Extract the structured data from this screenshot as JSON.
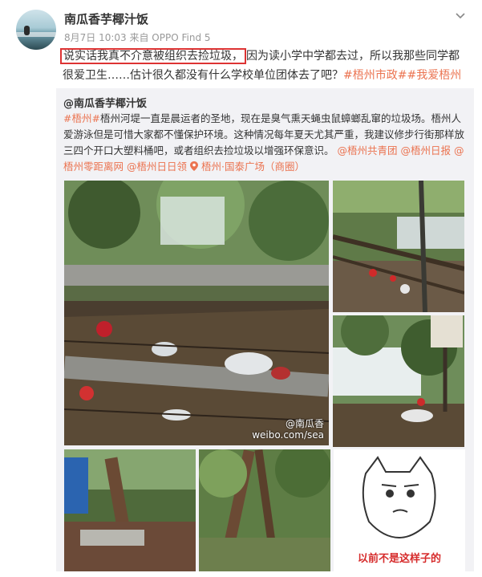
{
  "post": {
    "author": "南瓜香芋椰汁饭",
    "meta": "8月7日 10:03 来自 OPPO Find 5",
    "highlight": "说实话我真不介意被组织去捡垃圾，",
    "text_line1_rest": "因为读小学中学都去过，所以我那些同学都",
    "text_line2": "很爱卫生……估计很久都没有什么学校单位团体去了吧？",
    "tags": [
      "#梧州市政#",
      "#我爱梧州#"
    ]
  },
  "repost": {
    "author": "@南瓜香芋椰汁饭",
    "tag": "#梧州#",
    "text": "梧州河堤一直是晨运者的圣地，现在是臭气熏天蝇虫鼠蟑螂乱窜的垃圾场。梧州人爱游泳但是可惜大家都不懂保护环境。这种情况每年夏天尤其严重，我建议修步行街那样放三四个开口大塑料桶吧，或者组织去捡垃圾以增强环保意识。",
    "mentions": [
      "@梧州共青团",
      "@梧州日报",
      "@梧州零距离网",
      "@梧州日日领"
    ],
    "location": "梧州·国泰广场（商圈）",
    "watermark_line1": "@南瓜香",
    "watermark_line2": "weibo.com/sea",
    "meme_caption": "以前不是这样子的"
  },
  "colors": {
    "link": "#eb7350",
    "highlight_border": "#dd3333",
    "repost_bg": "#f2f2f5"
  }
}
